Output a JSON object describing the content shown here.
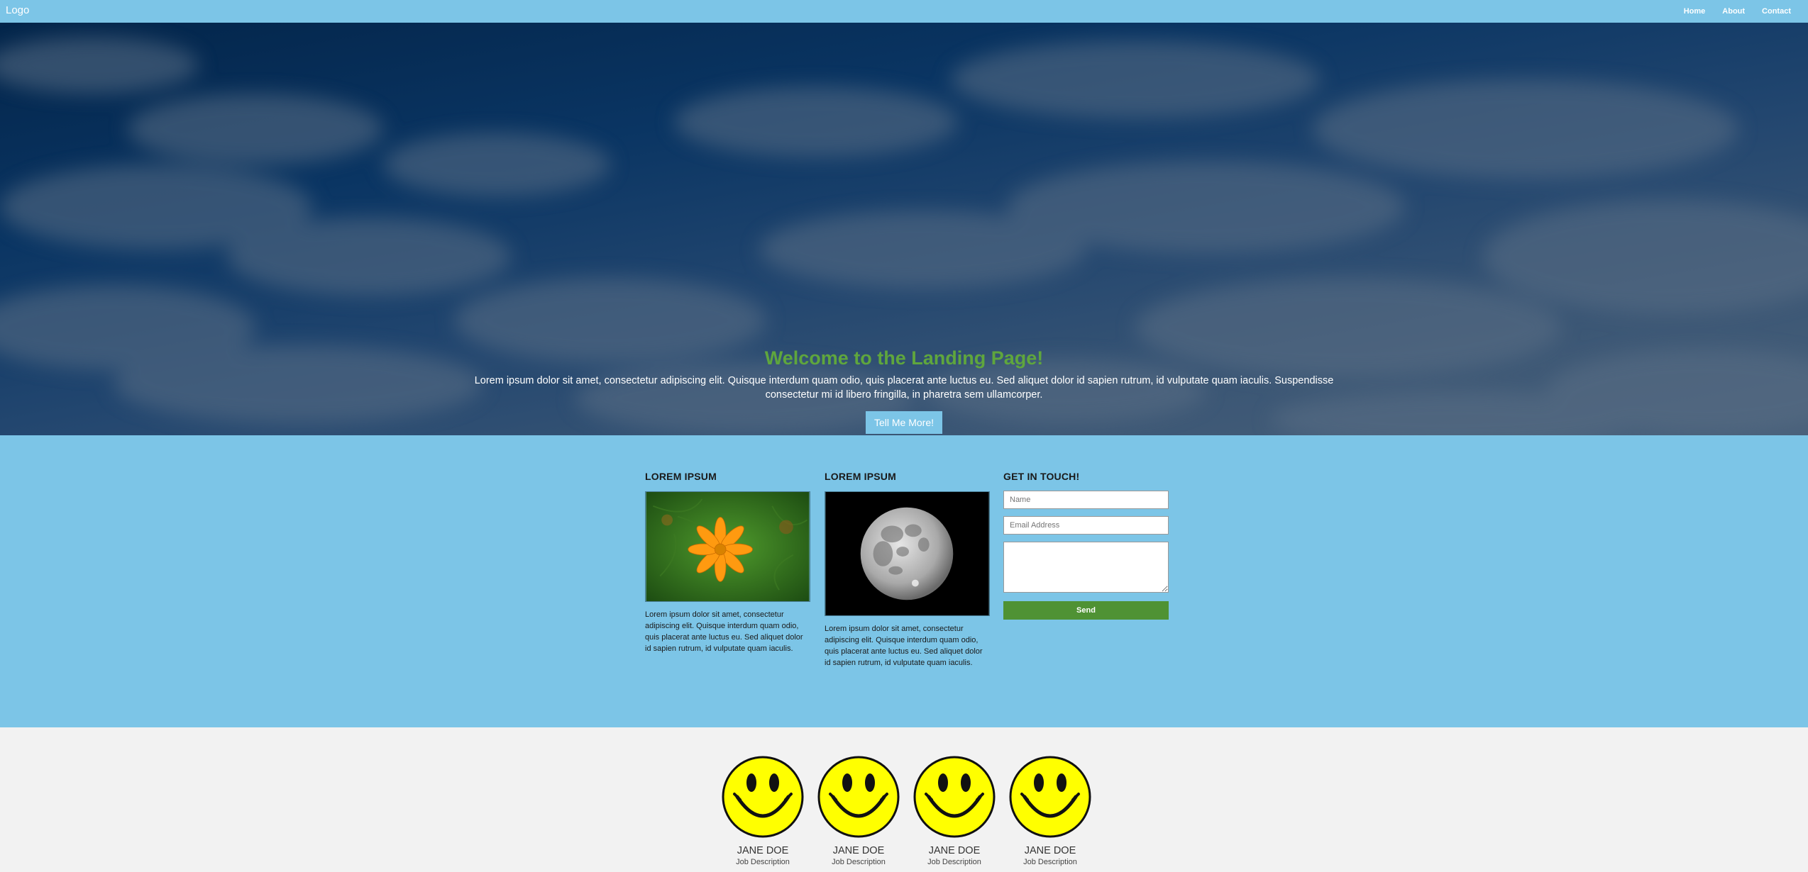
{
  "nav": {
    "logo": "Logo",
    "links": [
      "Home",
      "About",
      "Contact"
    ]
  },
  "hero": {
    "title": "Welcome to the Landing Page!",
    "text": "Lorem ipsum dolor sit amet, consectetur adipiscing elit. Quisque interdum quam odio, quis placerat ante luctus eu. Sed aliquet dolor id sapien rutrum, id vulputate quam iaculis. Suspendisse consectetur mi id libero fringilla, in pharetra sem ullamcorper.",
    "button": "Tell Me More!"
  },
  "features": {
    "col1": {
      "title": "LOREM IPSUM",
      "text": "Lorem ipsum dolor sit amet, consectetur adipiscing elit. Quisque interdum quam odio, quis placerat ante luctus eu. Sed aliquet dolor id sapien rutrum, id vulputate quam iaculis."
    },
    "col2": {
      "title": "LOREM IPSUM",
      "text": "Lorem ipsum dolor sit amet, consectetur adipiscing elit. Quisque interdum quam odio, quis placerat ante luctus eu. Sed aliquet dolor id sapien rutrum, id vulputate quam iaculis."
    },
    "contact": {
      "title": "GET IN TOUCH!",
      "name_placeholder": "Name",
      "email_placeholder": "Email Address",
      "send": "Send"
    }
  },
  "team": [
    {
      "name": "JANE DOE",
      "desc": "Job Description"
    },
    {
      "name": "JANE DOE",
      "desc": "Job Description"
    },
    {
      "name": "JANE DOE",
      "desc": "Job Description"
    },
    {
      "name": "JANE DOE",
      "desc": "Job Description"
    }
  ],
  "colors": {
    "accent": "#7cc5e7",
    "title_green": "#5fa63d",
    "send_green": "#4f9234",
    "smiley": "#ffff00"
  }
}
